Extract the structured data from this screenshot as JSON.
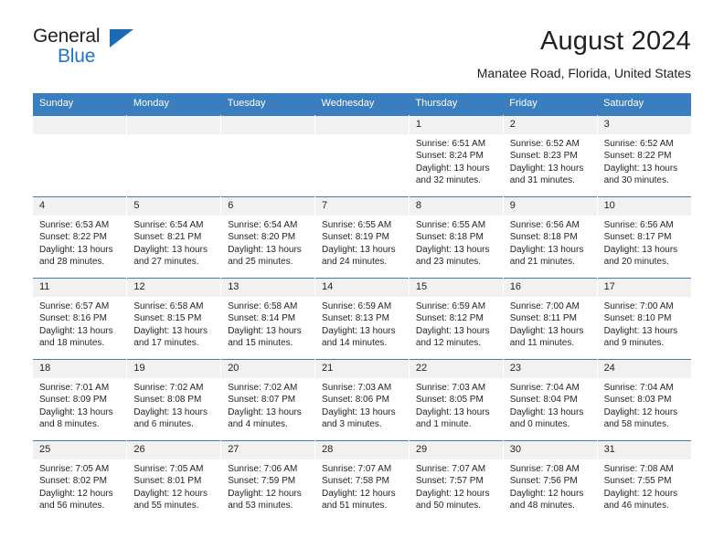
{
  "brand": {
    "word_one": "General",
    "word_two": "Blue",
    "triangle_icon": "triangle-icon"
  },
  "header": {
    "title": "August 2024",
    "subtitle": "Manatee Road, Florida, United States"
  },
  "colors": {
    "header_blue": "#3a7ebf",
    "brand_blue": "#1d76c4",
    "daynum_gray": "#f1f1f1",
    "text": "#231f20"
  },
  "weekdays": [
    "Sunday",
    "Monday",
    "Tuesday",
    "Wednesday",
    "Thursday",
    "Friday",
    "Saturday"
  ],
  "weeks": [
    [
      {
        "day": "",
        "lines": []
      },
      {
        "day": "",
        "lines": []
      },
      {
        "day": "",
        "lines": []
      },
      {
        "day": "",
        "lines": []
      },
      {
        "day": "1",
        "lines": [
          "Sunrise: 6:51 AM",
          "Sunset: 8:24 PM",
          "Daylight: 13 hours",
          "and 32 minutes."
        ]
      },
      {
        "day": "2",
        "lines": [
          "Sunrise: 6:52 AM",
          "Sunset: 8:23 PM",
          "Daylight: 13 hours",
          "and 31 minutes."
        ]
      },
      {
        "day": "3",
        "lines": [
          "Sunrise: 6:52 AM",
          "Sunset: 8:22 PM",
          "Daylight: 13 hours",
          "and 30 minutes."
        ]
      }
    ],
    [
      {
        "day": "4",
        "lines": [
          "Sunrise: 6:53 AM",
          "Sunset: 8:22 PM",
          "Daylight: 13 hours",
          "and 28 minutes."
        ]
      },
      {
        "day": "5",
        "lines": [
          "Sunrise: 6:54 AM",
          "Sunset: 8:21 PM",
          "Daylight: 13 hours",
          "and 27 minutes."
        ]
      },
      {
        "day": "6",
        "lines": [
          "Sunrise: 6:54 AM",
          "Sunset: 8:20 PM",
          "Daylight: 13 hours",
          "and 25 minutes."
        ]
      },
      {
        "day": "7",
        "lines": [
          "Sunrise: 6:55 AM",
          "Sunset: 8:19 PM",
          "Daylight: 13 hours",
          "and 24 minutes."
        ]
      },
      {
        "day": "8",
        "lines": [
          "Sunrise: 6:55 AM",
          "Sunset: 8:18 PM",
          "Daylight: 13 hours",
          "and 23 minutes."
        ]
      },
      {
        "day": "9",
        "lines": [
          "Sunrise: 6:56 AM",
          "Sunset: 8:18 PM",
          "Daylight: 13 hours",
          "and 21 minutes."
        ]
      },
      {
        "day": "10",
        "lines": [
          "Sunrise: 6:56 AM",
          "Sunset: 8:17 PM",
          "Daylight: 13 hours",
          "and 20 minutes."
        ]
      }
    ],
    [
      {
        "day": "11",
        "lines": [
          "Sunrise: 6:57 AM",
          "Sunset: 8:16 PM",
          "Daylight: 13 hours",
          "and 18 minutes."
        ]
      },
      {
        "day": "12",
        "lines": [
          "Sunrise: 6:58 AM",
          "Sunset: 8:15 PM",
          "Daylight: 13 hours",
          "and 17 minutes."
        ]
      },
      {
        "day": "13",
        "lines": [
          "Sunrise: 6:58 AM",
          "Sunset: 8:14 PM",
          "Daylight: 13 hours",
          "and 15 minutes."
        ]
      },
      {
        "day": "14",
        "lines": [
          "Sunrise: 6:59 AM",
          "Sunset: 8:13 PM",
          "Daylight: 13 hours",
          "and 14 minutes."
        ]
      },
      {
        "day": "15",
        "lines": [
          "Sunrise: 6:59 AM",
          "Sunset: 8:12 PM",
          "Daylight: 13 hours",
          "and 12 minutes."
        ]
      },
      {
        "day": "16",
        "lines": [
          "Sunrise: 7:00 AM",
          "Sunset: 8:11 PM",
          "Daylight: 13 hours",
          "and 11 minutes."
        ]
      },
      {
        "day": "17",
        "lines": [
          "Sunrise: 7:00 AM",
          "Sunset: 8:10 PM",
          "Daylight: 13 hours",
          "and 9 minutes."
        ]
      }
    ],
    [
      {
        "day": "18",
        "lines": [
          "Sunrise: 7:01 AM",
          "Sunset: 8:09 PM",
          "Daylight: 13 hours",
          "and 8 minutes."
        ]
      },
      {
        "day": "19",
        "lines": [
          "Sunrise: 7:02 AM",
          "Sunset: 8:08 PM",
          "Daylight: 13 hours",
          "and 6 minutes."
        ]
      },
      {
        "day": "20",
        "lines": [
          "Sunrise: 7:02 AM",
          "Sunset: 8:07 PM",
          "Daylight: 13 hours",
          "and 4 minutes."
        ]
      },
      {
        "day": "21",
        "lines": [
          "Sunrise: 7:03 AM",
          "Sunset: 8:06 PM",
          "Daylight: 13 hours",
          "and 3 minutes."
        ]
      },
      {
        "day": "22",
        "lines": [
          "Sunrise: 7:03 AM",
          "Sunset: 8:05 PM",
          "Daylight: 13 hours",
          "and 1 minute."
        ]
      },
      {
        "day": "23",
        "lines": [
          "Sunrise: 7:04 AM",
          "Sunset: 8:04 PM",
          "Daylight: 13 hours",
          "and 0 minutes."
        ]
      },
      {
        "day": "24",
        "lines": [
          "Sunrise: 7:04 AM",
          "Sunset: 8:03 PM",
          "Daylight: 12 hours",
          "and 58 minutes."
        ]
      }
    ],
    [
      {
        "day": "25",
        "lines": [
          "Sunrise: 7:05 AM",
          "Sunset: 8:02 PM",
          "Daylight: 12 hours",
          "and 56 minutes."
        ]
      },
      {
        "day": "26",
        "lines": [
          "Sunrise: 7:05 AM",
          "Sunset: 8:01 PM",
          "Daylight: 12 hours",
          "and 55 minutes."
        ]
      },
      {
        "day": "27",
        "lines": [
          "Sunrise: 7:06 AM",
          "Sunset: 7:59 PM",
          "Daylight: 12 hours",
          "and 53 minutes."
        ]
      },
      {
        "day": "28",
        "lines": [
          "Sunrise: 7:07 AM",
          "Sunset: 7:58 PM",
          "Daylight: 12 hours",
          "and 51 minutes."
        ]
      },
      {
        "day": "29",
        "lines": [
          "Sunrise: 7:07 AM",
          "Sunset: 7:57 PM",
          "Daylight: 12 hours",
          "and 50 minutes."
        ]
      },
      {
        "day": "30",
        "lines": [
          "Sunrise: 7:08 AM",
          "Sunset: 7:56 PM",
          "Daylight: 12 hours",
          "and 48 minutes."
        ]
      },
      {
        "day": "31",
        "lines": [
          "Sunrise: 7:08 AM",
          "Sunset: 7:55 PM",
          "Daylight: 12 hours",
          "and 46 minutes."
        ]
      }
    ]
  ]
}
